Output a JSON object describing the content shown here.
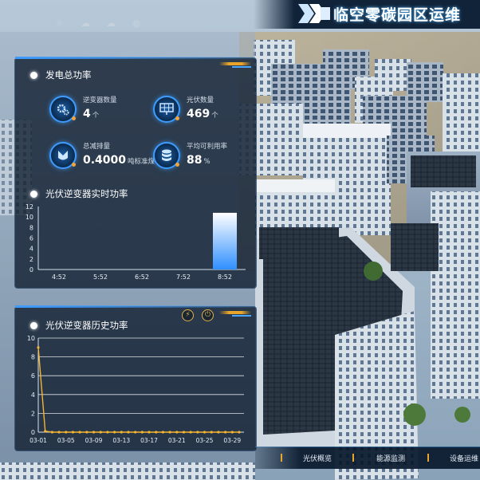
{
  "header": {
    "title": "临空零碳园区运维"
  },
  "top_icons": [
    "sun-icon",
    "cloud-sun-icon",
    "cloud-icon",
    "globe-icon"
  ],
  "generation_panel": {
    "title": "发电总功率",
    "stats": [
      {
        "label": "逆变器数量",
        "value": "4",
        "unit": "个",
        "icon": "gear-icon"
      },
      {
        "label": "光伏数量",
        "value": "469",
        "unit": "个",
        "icon": "solar-panel-icon"
      },
      {
        "label": "总减排量",
        "value": "0.4000",
        "unit": "吨标准煤",
        "icon": "leaf-icon"
      },
      {
        "label": "平均可利用率",
        "value": "88",
        "unit": "%",
        "icon": "database-icon"
      }
    ]
  },
  "realtime_chart": {
    "title": "光伏逆变器实时功率"
  },
  "history_chart": {
    "title": "光伏逆变器历史功率"
  },
  "chart_data": [
    {
      "type": "bar",
      "title": "光伏逆变器实时功率",
      "categories": [
        "4:52",
        "5:52",
        "6:52",
        "7:52",
        "8:52"
      ],
      "values": [
        0,
        0,
        0,
        0,
        10.8
      ],
      "yticks": [
        0,
        2,
        4,
        6,
        8,
        10,
        12
      ],
      "ylim": [
        0,
        12
      ],
      "grid": false,
      "colors": {
        "bar_top": "#ffffff",
        "bar_bottom": "#2f8fff"
      }
    },
    {
      "type": "line",
      "title": "光伏逆变器历史功率",
      "x": [
        "03-01",
        "03-02",
        "03-03",
        "03-04",
        "03-05",
        "03-06",
        "03-07",
        "03-08",
        "03-09",
        "03-10",
        "03-11",
        "03-12",
        "03-13",
        "03-14",
        "03-15",
        "03-16",
        "03-17",
        "03-18",
        "03-19",
        "03-20",
        "03-21",
        "03-22",
        "03-23",
        "03-24",
        "03-25",
        "03-26",
        "03-27",
        "03-28",
        "03-29",
        "03-30"
      ],
      "xticks": [
        "03-01",
        "03-05",
        "03-09",
        "03-13",
        "03-17",
        "03-21",
        "03-25",
        "03-29"
      ],
      "values": [
        9,
        0.1,
        0,
        0,
        0,
        0,
        0,
        0,
        0,
        0,
        0,
        0,
        0,
        0,
        0,
        0,
        0,
        0,
        0,
        0,
        0,
        0,
        0,
        0,
        0,
        0,
        0,
        0,
        0,
        0
      ],
      "yticks": [
        0,
        2,
        4,
        6,
        8,
        10
      ],
      "ylim": [
        0,
        10
      ],
      "grid": true,
      "colors": {
        "line": "#f5b531",
        "grid": "#ffffff"
      }
    }
  ],
  "tool_icons": [
    "lightning-icon",
    "power-icon"
  ],
  "bottom_nav": {
    "items": [
      "光伏概览",
      "能源监测",
      "设备运维"
    ]
  }
}
